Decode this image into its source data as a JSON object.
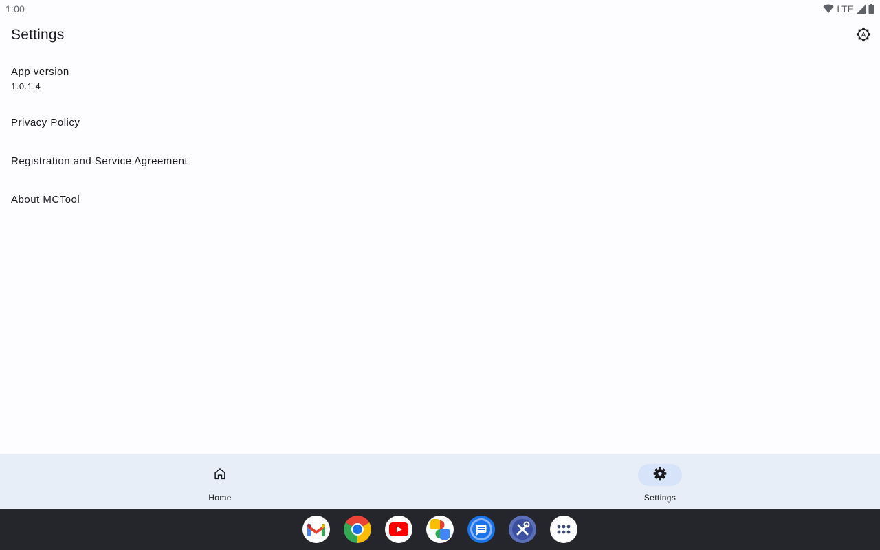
{
  "status_bar": {
    "time": "1:00",
    "network": "LTE"
  },
  "app_bar": {
    "title": "Settings",
    "theme_icon_letter": "A"
  },
  "settings": {
    "items": [
      {
        "title": "App version",
        "subtitle": "1.0.1.4"
      },
      {
        "title": "Privacy Policy"
      },
      {
        "title": "Registration and Service Agreement"
      },
      {
        "title": "About MCTool"
      }
    ]
  },
  "bottom_nav": {
    "items": [
      {
        "label": "Home",
        "icon": "home-icon",
        "active": false
      },
      {
        "label": "Settings",
        "icon": "gear-icon",
        "active": true
      }
    ]
  },
  "taskbar": {
    "apps": [
      "gmail-icon",
      "chrome-icon",
      "youtube-icon",
      "photos-icon",
      "messages-icon",
      "mctool-icon",
      "app-drawer-icon"
    ]
  },
  "colors": {
    "background": "#fdfcff",
    "nav_background": "#e8eef7",
    "nav_active_indicator": "#d7e3f8",
    "taskbar": "#25262b"
  }
}
